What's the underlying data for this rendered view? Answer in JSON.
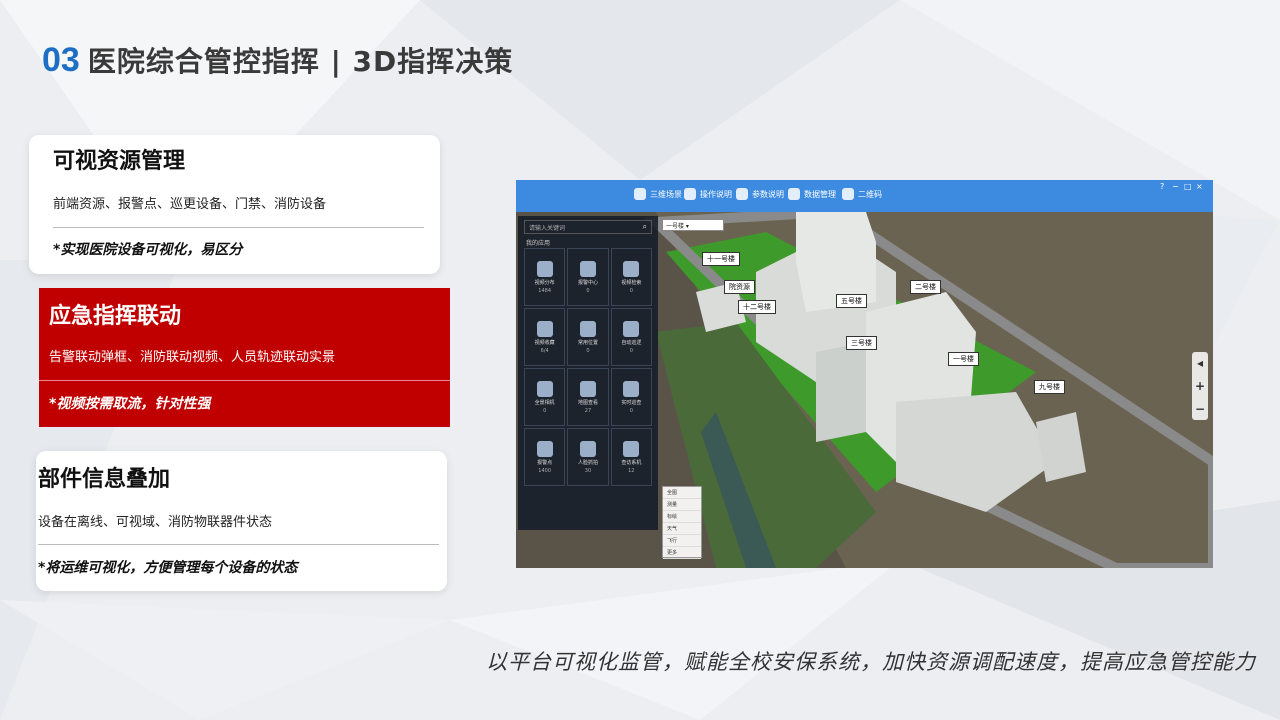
{
  "title": {
    "number": "03",
    "text": "医院综合管控指挥 | 3D指挥决策"
  },
  "cards": [
    {
      "heading": "可视资源管理",
      "desc": "前端资源、报警点、巡更设备、门禁、消防设备",
      "note": "*实现医院设备可视化，易区分"
    },
    {
      "heading": "应急指挥联动",
      "desc": "告警联动弹框、消防联动视频、人员轨迹联动实景",
      "note": "*视频按需取流，针对性强"
    },
    {
      "heading": "部件信息叠加",
      "desc": "设备在离线、可视域、消防物联器件状态",
      "note": "*将运维可视化，方便管理每个设备的状态"
    }
  ],
  "footer": "以平台可视化监管，赋能全校安保系统，加快资源调配速度，提高应急管控能力",
  "app": {
    "toolbar": [
      "三维场景",
      "操作说明",
      "参数说明",
      "数据管理",
      "二维码"
    ],
    "search_placeholder": "请输入关键词",
    "panel_label": "我的应用",
    "tiles": [
      {
        "name": "视频分布",
        "value": "1484",
        "icon": "video-icon"
      },
      {
        "name": "报警中心",
        "value": "0",
        "icon": "alarm-door-icon"
      },
      {
        "name": "视频检索",
        "value": "0",
        "icon": "database-icon"
      },
      {
        "name": "视频收藏",
        "value": "6/4",
        "icon": "calendar-icon"
      },
      {
        "name": "常用位置",
        "value": "0",
        "icon": "location-icon"
      },
      {
        "name": "自动巡逻",
        "value": "0",
        "icon": "patrol-icon"
      },
      {
        "name": "全景相机",
        "value": "0",
        "icon": "camera-icon"
      },
      {
        "name": "地图查看",
        "value": "27",
        "icon": "map-icon"
      },
      {
        "name": "实时巡查",
        "value": "0",
        "icon": "target-icon"
      },
      {
        "name": "报警点",
        "value": "1400",
        "icon": "siren-icon"
      },
      {
        "name": "人脸抓拍",
        "value": "30",
        "icon": "face-icon"
      },
      {
        "name": "查访系机",
        "value": "12",
        "icon": "people-icon"
      }
    ],
    "dropdown": "一号楼",
    "tools": [
      "全图",
      "测量",
      "标绘",
      "天气",
      "飞行",
      "更多"
    ],
    "zoom": [
      "◂",
      "+",
      "−"
    ],
    "building_labels": [
      "十一号楼",
      "院资源",
      "十二号楼",
      "五号楼",
      "二号楼",
      "三号楼",
      "一号楼",
      "九号楼"
    ]
  }
}
